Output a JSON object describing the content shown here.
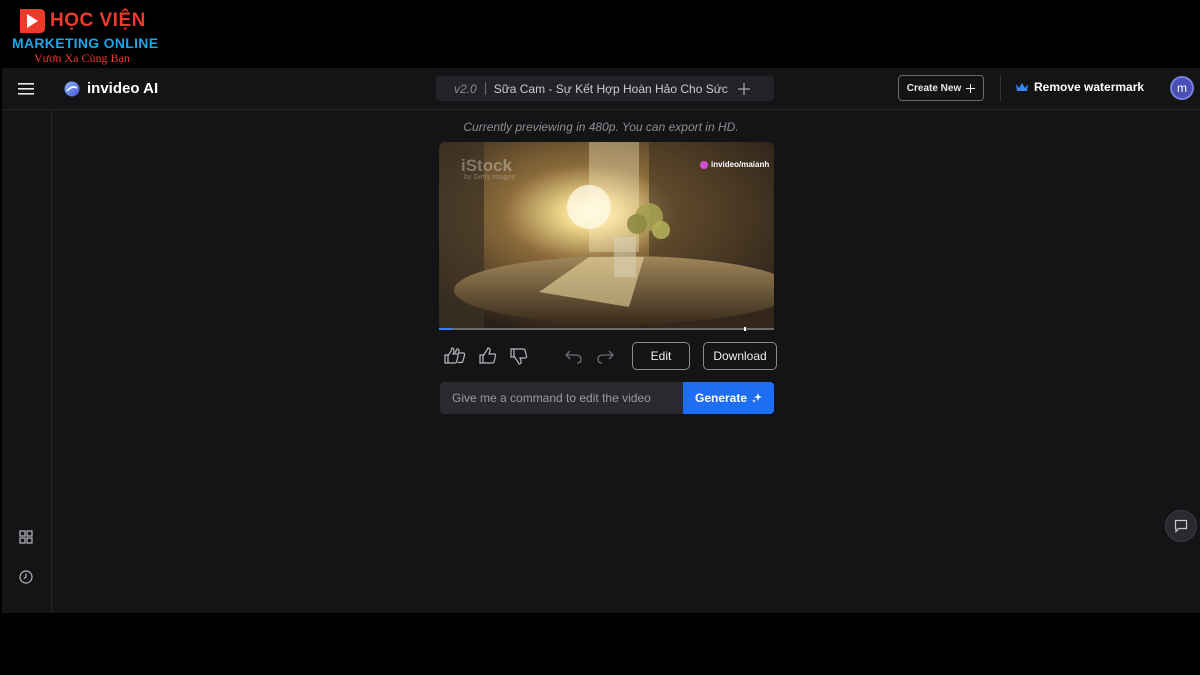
{
  "brand_overlay": {
    "line1": "HỌC VIỆN",
    "line2": "MARKETING ONLINE",
    "slogan": "Vươn Xa Cùng Bạn",
    "colors": {
      "red": "#ee3a2b",
      "blue": "#21a3e8"
    }
  },
  "header": {
    "app_name": "invideo AI",
    "version": "v2.0",
    "project_title": "Sữa Cam - Sự Kết Hợp Hoàn Hảo Cho Sức Kh",
    "create_new_label": "Create New",
    "remove_watermark_label": "Remove watermark",
    "avatar_initial": "m",
    "icons": [
      "menu-icon",
      "invideo-logo-icon",
      "plus-icon",
      "crown-icon"
    ]
  },
  "sidebar": {
    "icons": [
      "grid-icon",
      "history-clock-icon"
    ]
  },
  "preview": {
    "note": "Currently previewing in 480p. You can export in HD.",
    "watermark_stock": "iStock",
    "watermark_stock_sub": "by Getty Images",
    "watermark_brand": "invideo/maianh",
    "progress": 0.04,
    "handle_position": 0.91
  },
  "controls": {
    "edit_label": "Edit",
    "download_label": "Download",
    "icons": [
      "double-thumbs-up-icon",
      "thumbs-up-icon",
      "thumbs-down-icon",
      "undo-icon",
      "redo-icon"
    ]
  },
  "command": {
    "placeholder": "Give me a command to edit the video",
    "value": "",
    "generate_label": "Generate"
  },
  "theme": {
    "background": "#141416",
    "accent": "#1d6ef2",
    "avatar": "#4a4fb8"
  }
}
